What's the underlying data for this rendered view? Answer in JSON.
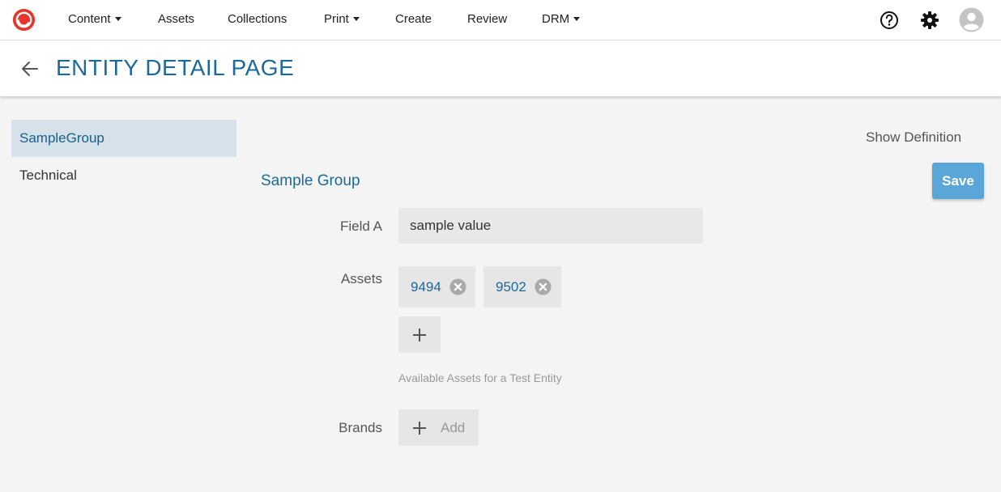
{
  "nav": {
    "items": [
      {
        "label": "Content",
        "dropdown": true
      },
      {
        "label": "Assets",
        "dropdown": false
      },
      {
        "label": "Collections",
        "dropdown": false
      },
      {
        "label": "Print",
        "dropdown": true
      },
      {
        "label": "Create",
        "dropdown": false
      },
      {
        "label": "Review",
        "dropdown": false
      },
      {
        "label": "DRM",
        "dropdown": true
      }
    ],
    "icons": [
      "help-icon",
      "gear-icon",
      "user-avatar-icon"
    ]
  },
  "header": {
    "title": "ENTITY DETAIL PAGE"
  },
  "sidebar": {
    "items": [
      {
        "label": "SampleGroup",
        "active": true
      },
      {
        "label": "Technical",
        "active": false
      }
    ]
  },
  "actions": {
    "show_definition": "Show Definition",
    "save": "Save"
  },
  "group": {
    "title": "Sample Group",
    "field_a": {
      "label": "Field A",
      "value": "sample value"
    },
    "assets": {
      "label": "Assets",
      "chips": [
        "9494",
        "9502"
      ],
      "hint": "Available Assets for a Test Entity"
    },
    "brands": {
      "label": "Brands",
      "add_label": "Add"
    }
  },
  "colors": {
    "brand_red": "#e8352b",
    "accent_blue": "#1d6a99",
    "save_blue": "#5aa6d8",
    "active_side": "#d5e2ea"
  }
}
